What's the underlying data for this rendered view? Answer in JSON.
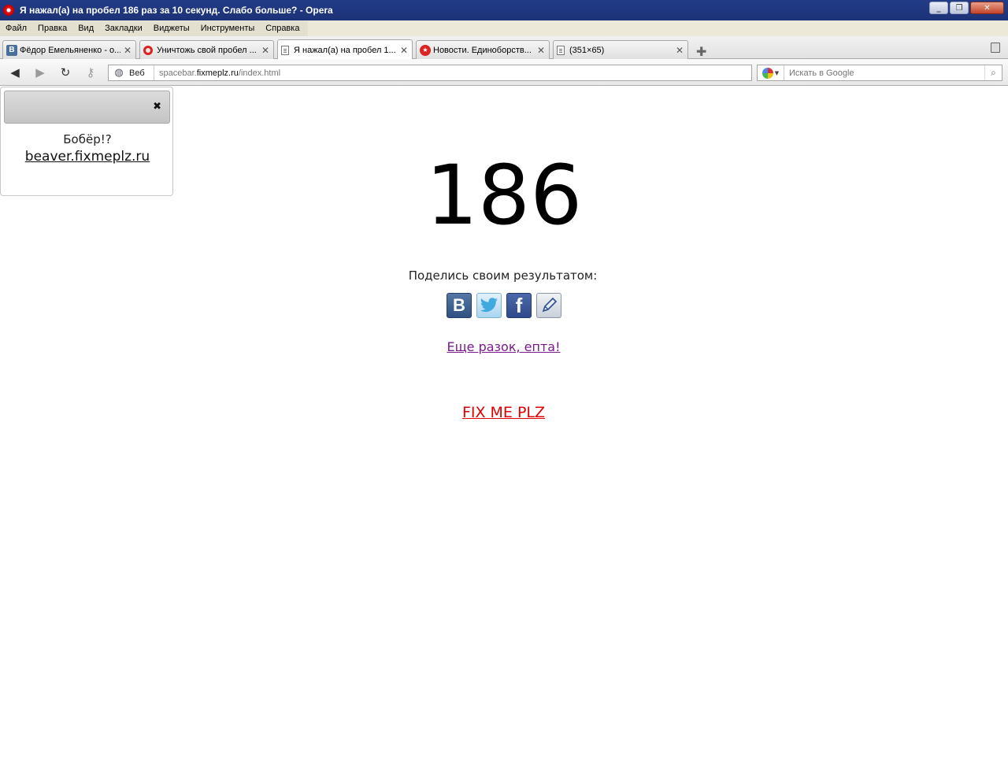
{
  "window": {
    "title": "Я нажал(а) на пробел 186 раз за 10 секунд. Слабо больше? - Opera",
    "minimize_label": "_",
    "restore_label": "❐",
    "close_label": "✕"
  },
  "menu": {
    "items": [
      "Файл",
      "Правка",
      "Вид",
      "Закладки",
      "Виджеты",
      "Инструменты",
      "Справка"
    ]
  },
  "tabs": [
    {
      "label": "Фёдор Емельяненко - о...",
      "icon": "vk-icon",
      "active": false
    },
    {
      "label": "Уничтожь свой пробел ...",
      "icon": "opera-ring-icon",
      "active": false
    },
    {
      "label": "Я нажал(а) на пробел 1...",
      "icon": "page-icon",
      "active": true
    },
    {
      "label": "Новости. Единоборств...",
      "icon": "news-icon",
      "active": false
    },
    {
      "label": "(351×65)",
      "icon": "page-icon",
      "active": false
    }
  ],
  "tab_close_label": "✕",
  "address_bar": {
    "web_label": "Веб",
    "url_prefix": "spacebar.",
    "url_host": "fixmeplz.ru",
    "url_path": "/index.html"
  },
  "search": {
    "placeholder": "Искать в Google"
  },
  "popup": {
    "question": "Бобёр!?",
    "link": "beaver.fixmeplz.ru",
    "close_label": "✖"
  },
  "page": {
    "count": "186",
    "share_label": "Поделись своим результатом:",
    "share_buttons": [
      "vkontakte",
      "twitter",
      "facebook",
      "livejournal"
    ],
    "again_link": "Еще разок, епта!",
    "fix_link": "FIX ME PLZ"
  },
  "colors": {
    "titlebar": "#223c86",
    "visited_link": "#7b1a8c",
    "fix_link": "#e00000"
  }
}
